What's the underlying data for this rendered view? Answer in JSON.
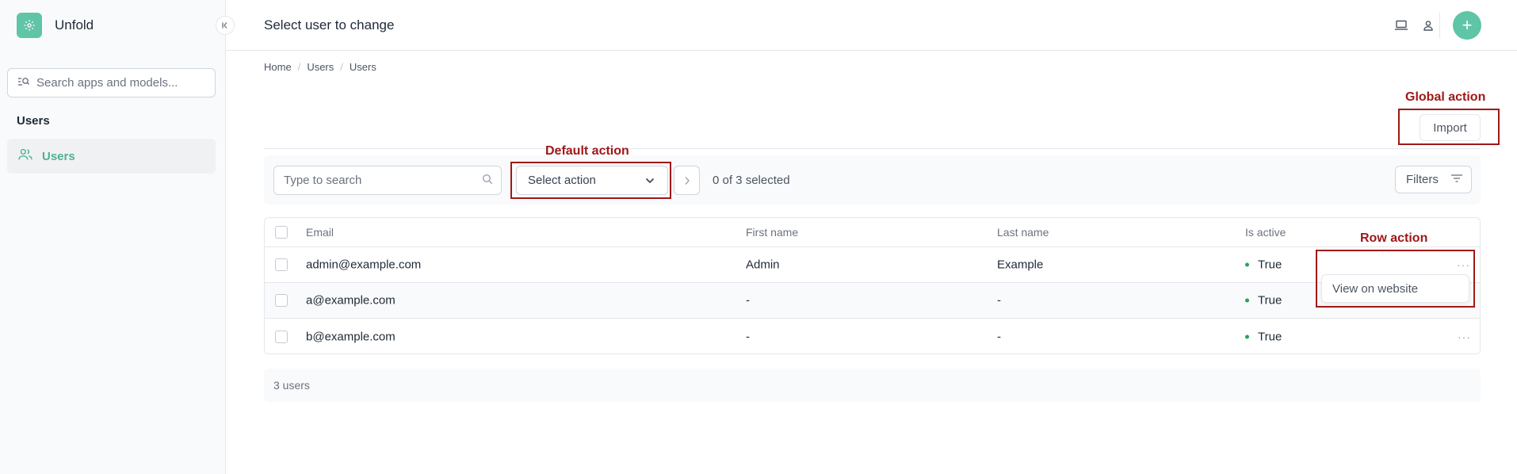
{
  "app": {
    "name": "Unfold",
    "brand_color": "#5fc5a6"
  },
  "sidebar": {
    "search_placeholder": "Search apps and models...",
    "section_title": "Users",
    "items": [
      {
        "label": "Users",
        "icon": "users-icon",
        "active": true
      }
    ]
  },
  "header": {
    "title": "Select user to change",
    "icons": [
      "laptop-icon",
      "person-icon"
    ],
    "add_label": "+"
  },
  "breadcrumb": [
    "Home",
    "Users",
    "Users"
  ],
  "annotations": {
    "global": "Global action",
    "default": "Default action",
    "row": "Row action",
    "color": "#a01818"
  },
  "global_actions": {
    "import_label": "Import"
  },
  "toolbar": {
    "search_placeholder": "Type to search",
    "action_select": "Select action",
    "selected_count": "0 of 3 selected",
    "filters_label": "Filters"
  },
  "table": {
    "columns": [
      "Email",
      "First name",
      "Last name",
      "Is active"
    ],
    "rows": [
      {
        "email": "admin@example.com",
        "first_name": "Admin",
        "last_name": "Example",
        "is_active": "True"
      },
      {
        "email": "a@example.com",
        "first_name": "-",
        "last_name": "-",
        "is_active": "True"
      },
      {
        "email": "b@example.com",
        "first_name": "-",
        "last_name": "-",
        "is_active": "True"
      }
    ],
    "row_menu": {
      "items": [
        "View on website"
      ]
    },
    "row_menu_glyph": "···"
  },
  "footer": {
    "count_text": "3 users"
  }
}
